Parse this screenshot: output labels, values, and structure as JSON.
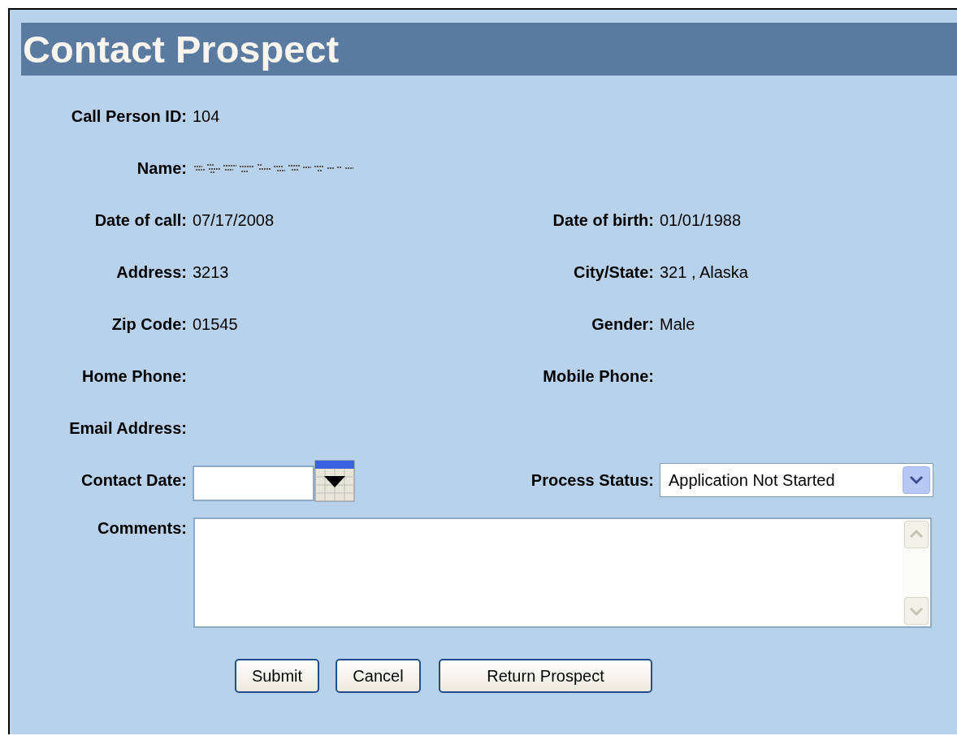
{
  "title": "Contact Prospect",
  "rows": [
    [
      {
        "label": "Call Person ID:",
        "kind": "text",
        "value": "104"
      }
    ],
    [
      {
        "label": "Name:",
        "kind": "redacted"
      }
    ],
    [
      {
        "label": "Date of call:",
        "kind": "text",
        "value": "07/17/2008"
      },
      {
        "label": "Date of birth:",
        "kind": "text",
        "value": "01/01/1988"
      }
    ],
    [
      {
        "label": "Address:",
        "kind": "text",
        "value": "3213"
      },
      {
        "label": "City/State:",
        "kind": "text",
        "value": "321  , Alaska"
      }
    ],
    [
      {
        "label": "Zip Code:",
        "kind": "text",
        "value": "01545"
      },
      {
        "label": "Gender:",
        "kind": "text",
        "value": "Male"
      }
    ],
    [
      {
        "label": "Home Phone:",
        "kind": "text"
      },
      {
        "label": "Mobile Phone:",
        "kind": "text"
      }
    ],
    [
      {
        "label": "Email Address:",
        "kind": "text"
      }
    ]
  ],
  "contact_date": {
    "label": "Contact Date:"
  },
  "process_status": {
    "label": "Process Status:",
    "value": "Application Not Started"
  },
  "comments": {
    "label": "Comments:"
  },
  "buttons": [
    "Submit",
    "Cancel",
    "Return Prospect"
  ]
}
